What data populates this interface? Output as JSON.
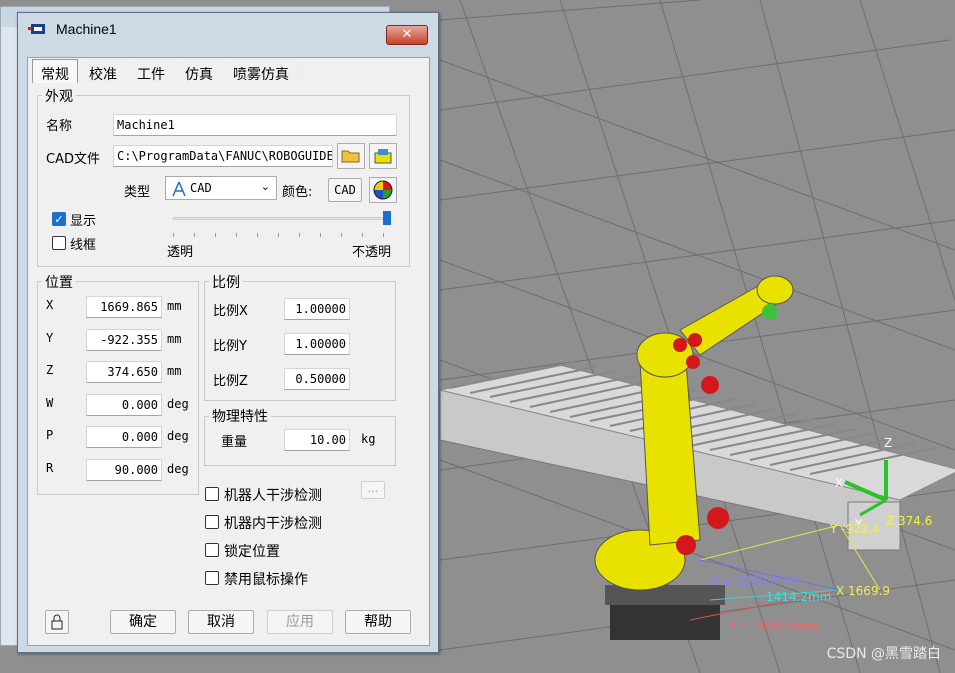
{
  "dialog": {
    "title": "Machine1",
    "close_label": "✕",
    "tabs": [
      "常规",
      "校准",
      "工件",
      "仿真",
      "喷雾仿真"
    ]
  },
  "appearance": {
    "group_label": "外观",
    "name_label": "名称",
    "name_value": "Machine1",
    "cad_label": "CAD文件",
    "cad_value": "C:\\ProgramData\\FANUC\\ROBOGUIDE",
    "type_label": "类型",
    "type_value": "CAD",
    "color_label": "颜色:",
    "color_button": "CAD",
    "show_label": "显示",
    "show_checked": true,
    "wireframe_label": "线框",
    "wireframe_checked": false,
    "transparent_label": "透明",
    "opaque_label": "不透明",
    "opacity_level": 1.0
  },
  "position": {
    "group_label": "位置",
    "rows": [
      {
        "label": "X",
        "value": "1669.865",
        "unit": "mm"
      },
      {
        "label": "Y",
        "value": "-922.355",
        "unit": "mm"
      },
      {
        "label": "Z",
        "value": "374.650",
        "unit": "mm"
      },
      {
        "label": "W",
        "value": "0.000",
        "unit": "deg"
      },
      {
        "label": "P",
        "value": "0.000",
        "unit": "deg"
      },
      {
        "label": "R",
        "value": "90.000",
        "unit": "deg"
      }
    ]
  },
  "scale": {
    "group_label": "比例",
    "rows": [
      {
        "label": "比例X",
        "value": "1.00000"
      },
      {
        "label": "比例Y",
        "value": "1.00000"
      },
      {
        "label": "比例Z",
        "value": "0.50000"
      }
    ]
  },
  "physics": {
    "group_label": "物理特性",
    "weight_label": "重量",
    "weight_value": "10.00",
    "weight_unit": "kg"
  },
  "checks": [
    {
      "label": "机器人干涉检测",
      "checked": false
    },
    {
      "label": "机器内干涉检测",
      "checked": false
    },
    {
      "label": "锁定位置",
      "checked": false
    },
    {
      "label": "禁用鼠标操作",
      "checked": false
    }
  ],
  "ellipsis_label": "...",
  "buttons": {
    "ok": "确定",
    "cancel": "取消",
    "apply": "应用",
    "help": "帮助"
  },
  "scene": {
    "axis_z": "Z",
    "axis_x": "X",
    "axis_y": "Y",
    "dim_y_label": "Y -922.4",
    "dim_z_label": "Z 374.6",
    "dim_x_label": "X 1669.9",
    "dist_label": "1414.2mm",
    "x_ref_label": "X = 1000.0mm",
    "y_ref_label": "Y = 1000.0mm",
    "watermark": "CSDN @黑雪踏白"
  },
  "colors": {
    "robot_yellow": "#e9e200",
    "robot_red": "#d4171a",
    "accent_blue": "#1a6fd1",
    "grid_bg": "#8f8f8f"
  }
}
